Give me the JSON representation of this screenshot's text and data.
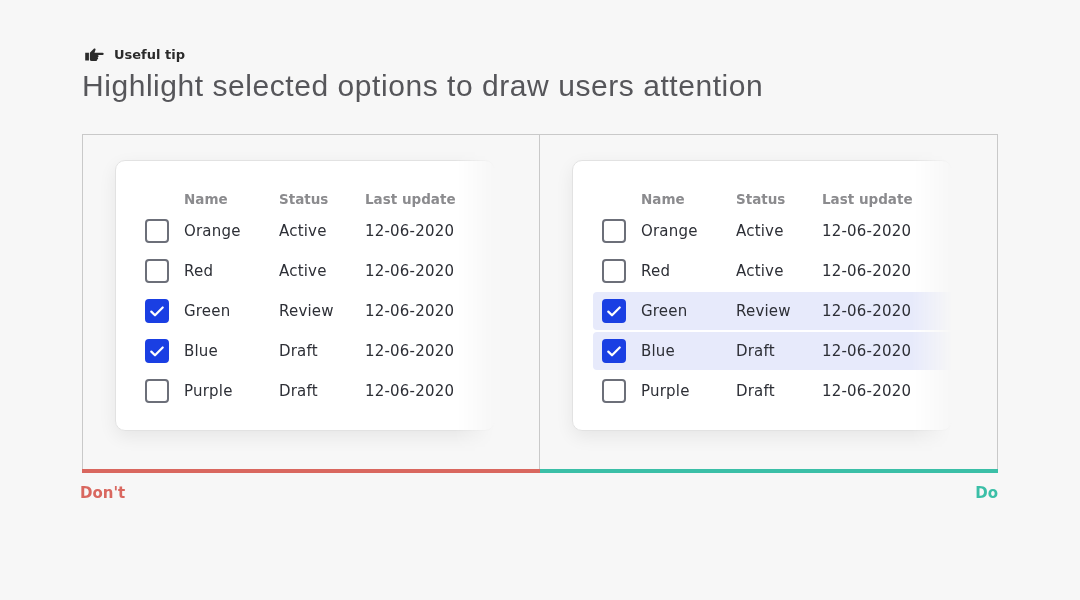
{
  "tip": {
    "label": "Useful tip"
  },
  "title": "Highlight selected options to draw users attention",
  "examples": [
    {
      "kind": "dont",
      "label": "Don't",
      "color": "#d9675f",
      "columns": [
        "Name",
        "Status",
        "Last update"
      ],
      "rows": [
        {
          "name": "Orange",
          "status": "Active",
          "last_update": "12-06-2020",
          "checked": false
        },
        {
          "name": "Red",
          "status": "Active",
          "last_update": "12-06-2020",
          "checked": false
        },
        {
          "name": "Green",
          "status": "Review",
          "last_update": "12-06-2020",
          "checked": true
        },
        {
          "name": "Blue",
          "status": "Draft",
          "last_update": "12-06-2020",
          "checked": true
        },
        {
          "name": "Purple",
          "status": "Draft",
          "last_update": "12-06-2020",
          "checked": false
        }
      ]
    },
    {
      "kind": "do",
      "label": "Do",
      "color": "#3bbfa7",
      "columns": [
        "Name",
        "Status",
        "Last update"
      ],
      "rows": [
        {
          "name": "Orange",
          "status": "Active",
          "last_update": "12-06-2020",
          "checked": false
        },
        {
          "name": "Red",
          "status": "Active",
          "last_update": "12-06-2020",
          "checked": false
        },
        {
          "name": "Green",
          "status": "Review",
          "last_update": "12-06-2020",
          "checked": true
        },
        {
          "name": "Blue",
          "status": "Draft",
          "last_update": "12-06-2020",
          "checked": true
        },
        {
          "name": "Purple",
          "status": "Draft",
          "last_update": "12-06-2020",
          "checked": false
        }
      ]
    }
  ]
}
